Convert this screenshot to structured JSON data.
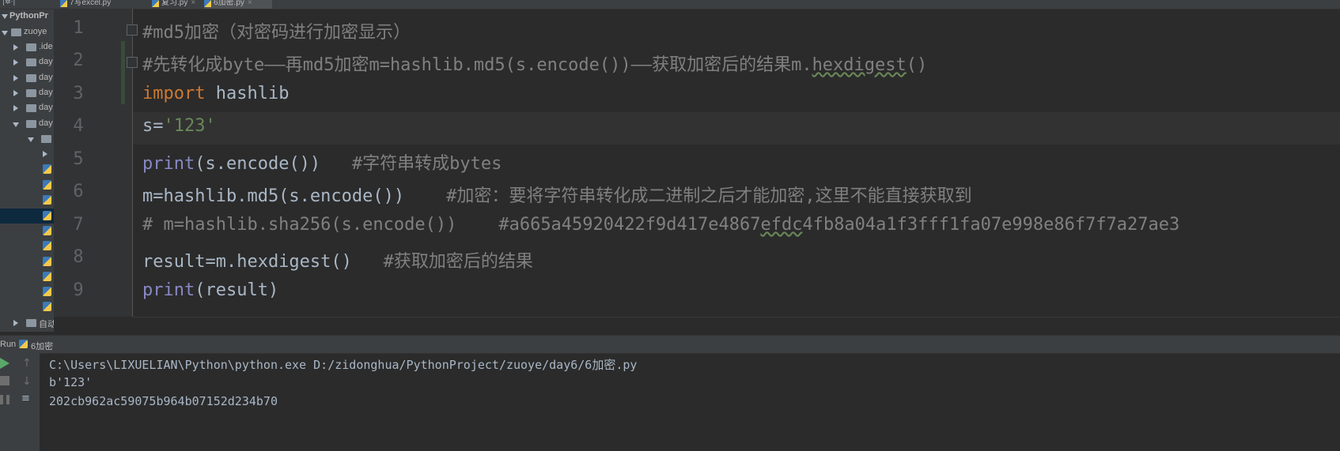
{
  "project_panel": {
    "title": "PythonPr",
    "root": "zuoye",
    "items": [
      {
        "label": ".ide",
        "kind": "folder",
        "expanded": false
      },
      {
        "label": "day",
        "kind": "folder",
        "expanded": false
      },
      {
        "label": "day",
        "kind": "folder",
        "expanded": false
      },
      {
        "label": "day",
        "kind": "folder",
        "expanded": false
      },
      {
        "label": "day",
        "kind": "folder",
        "expanded": false
      },
      {
        "label": "day",
        "kind": "folder",
        "expanded": true
      },
      {
        "label": "",
        "kind": "folder",
        "expanded": true
      },
      {
        "label": "",
        "kind": "folder",
        "expanded": false
      }
    ],
    "bottom_folder": "自动"
  },
  "tabs": [
    {
      "label": "7写excel.py",
      "active": false
    },
    {
      "label": "复习.py",
      "active": false
    },
    {
      "label": "6加密.py",
      "active": true
    }
  ],
  "editor": {
    "line_numbers": [
      "1",
      "2",
      "3",
      "4",
      "5",
      "6",
      "7",
      "8",
      "9"
    ],
    "lines": [
      "#md5加密（对密码进行加密显示）",
      "#先转化成byte——再md5加密m=hashlib.md5(s.encode())——获取加密后的结果m.hexdigest()",
      "import hashlib",
      "s='123'",
      "print(s.encode())   #字符串转成bytes",
      "m=hashlib.md5(s.encode())    #加密：要将字符串转化成二进制之后才能加密,这里不能直接获取到",
      "# m=hashlib.sha256(s.encode())    #a665a45920422f9d417e4867efdc4fb8a04a1f3fff1fa07e998e86f7f7a27ae3",
      "result=m.hexdigest()   #获取加密后的结果",
      "print(result)"
    ],
    "tokens": {
      "l2_a": "#先转化成byte——再md5加密m=hashlib.md5(s.encode())——获取加密后的结果m.",
      "l2_b": "hexdigest",
      "l2_c": "()",
      "l3_kw": "import",
      "l3_rest": " hashlib",
      "l4_a": "s=",
      "l4_str": "'123'",
      "l5_fn": "print",
      "l5_rest": "(s.encode())   ",
      "l5_com": "#字符串转成bytes",
      "l6_code": "m=hashlib.md5(s.encode())    ",
      "l6_com": "#加密：要将字符串转化成二进制之后才能加密,这里不能直接获取到",
      "l7_a": "# m=hashlib.sha256(s.encode())    #a665a45920422f9d417e4867",
      "l7_b": "efdc",
      "l7_c": "4fb8a04a1f3fff1fa07e998e86f7f7a27ae3",
      "l8_code": "result=m.hexdigest()   ",
      "l8_com": "#获取加密后的结果",
      "l9_fn": "print",
      "l9_rest": "(result)"
    }
  },
  "run_panel": {
    "label": "Run",
    "config": "6加密",
    "output": [
      "C:\\Users\\LIXUELIAN\\Python\\python.exe D:/zidonghua/PythonProject/zuoye/day6/6加密.py",
      "b'123'",
      "202cb962ac59075b964b07152d234b70"
    ]
  },
  "colors": {
    "background": "#2b2b2b",
    "comment": "#808080",
    "keyword": "#cc7832",
    "string": "#6a8759",
    "builtin": "#8888c6",
    "text": "#a9b7c6"
  }
}
